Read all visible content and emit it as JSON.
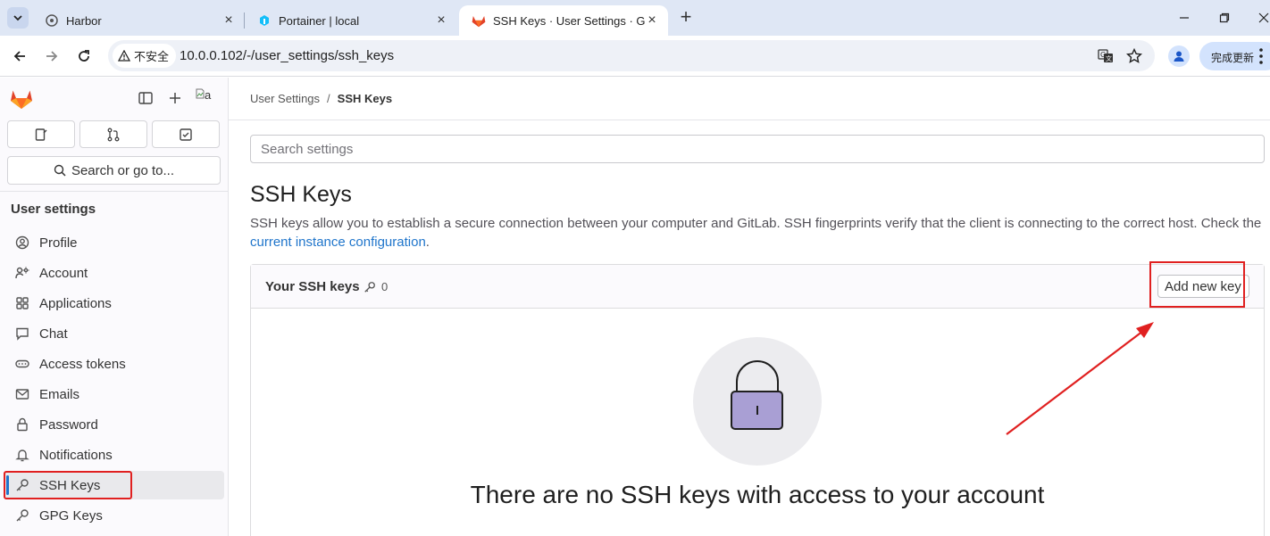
{
  "browser": {
    "tabs": [
      {
        "title": "Harbor",
        "icon": "harbor-icon"
      },
      {
        "title": "Portainer | local",
        "icon": "portainer-icon"
      },
      {
        "title": "SSH Keys · User Settings · GitLab",
        "icon": "gitlab-icon",
        "active": true
      }
    ],
    "security_label": "不安全",
    "url": "10.0.0.102/-/user_settings/ssh_keys",
    "update_button": "完成更新"
  },
  "sidebar": {
    "search_label": "Search or go to...",
    "heading": "User settings",
    "avatar_alt": "a",
    "items": [
      {
        "label": "Profile",
        "icon": "profile-icon"
      },
      {
        "label": "Account",
        "icon": "account-icon"
      },
      {
        "label": "Applications",
        "icon": "applications-icon"
      },
      {
        "label": "Chat",
        "icon": "chat-icon"
      },
      {
        "label": "Access tokens",
        "icon": "token-icon"
      },
      {
        "label": "Emails",
        "icon": "email-icon"
      },
      {
        "label": "Password",
        "icon": "lock-icon"
      },
      {
        "label": "Notifications",
        "icon": "bell-icon"
      },
      {
        "label": "SSH Keys",
        "icon": "key-icon",
        "active": true
      },
      {
        "label": "GPG Keys",
        "icon": "key-icon"
      }
    ]
  },
  "main": {
    "breadcrumb": [
      "User Settings",
      "SSH Keys"
    ],
    "breadcrumb_sep": "/",
    "search_placeholder": "Search settings",
    "title": "SSH Keys",
    "description": "SSH keys allow you to establish a secure connection between your computer and GitLab. SSH fingerprints verify that the client is connecting to the correct host. Check the",
    "description_link": "current instance configuration",
    "description_end": ".",
    "card": {
      "title": "Your SSH keys",
      "count": "0",
      "add_button": "Add new key",
      "empty_title": "There are no SSH keys with access to your account"
    }
  },
  "colors": {
    "annotation": "#e02020",
    "link": "#1f75cb",
    "lock": "#a99fd4"
  }
}
